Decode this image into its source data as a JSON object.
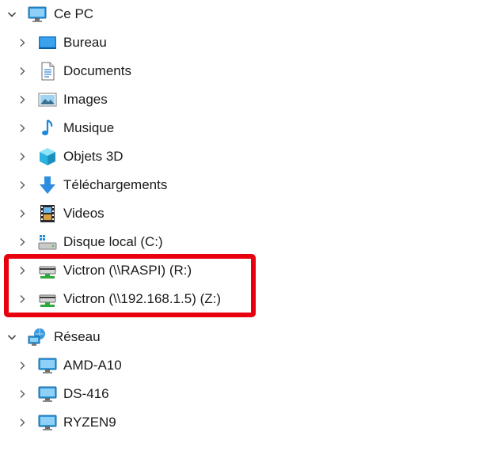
{
  "tree": {
    "this_pc": {
      "label": "Ce PC",
      "icon": "computer-icon",
      "expanded": true,
      "children": [
        {
          "label": "Bureau",
          "icon": "desktop-folder-icon"
        },
        {
          "label": "Documents",
          "icon": "documents-icon"
        },
        {
          "label": "Images",
          "icon": "images-icon"
        },
        {
          "label": "Musique",
          "icon": "music-note-icon"
        },
        {
          "label": "Objets 3D",
          "icon": "3d-objects-icon"
        },
        {
          "label": "Téléchargements",
          "icon": "download-arrow-icon"
        },
        {
          "label": "Videos",
          "icon": "film-strip-icon"
        },
        {
          "label": "Disque local (C:)",
          "icon": "local-disk-icon"
        },
        {
          "label": "Victron (\\\\RASPI) (R:)",
          "icon": "network-drive-icon"
        },
        {
          "label": "Victron (\\\\192.168.1.5) (Z:)",
          "icon": "network-drive-icon"
        }
      ]
    },
    "network": {
      "label": "Réseau",
      "icon": "network-icon",
      "expanded": true,
      "children": [
        {
          "label": "AMD-A10",
          "icon": "computer-icon"
        },
        {
          "label": "DS-416",
          "icon": "computer-icon"
        },
        {
          "label": "RYZEN9",
          "icon": "computer-icon"
        }
      ]
    }
  },
  "colors": {
    "highlight": "#e8000f",
    "chevron": "#5a5a5a",
    "monitor_blue": "#1e8fd6"
  }
}
